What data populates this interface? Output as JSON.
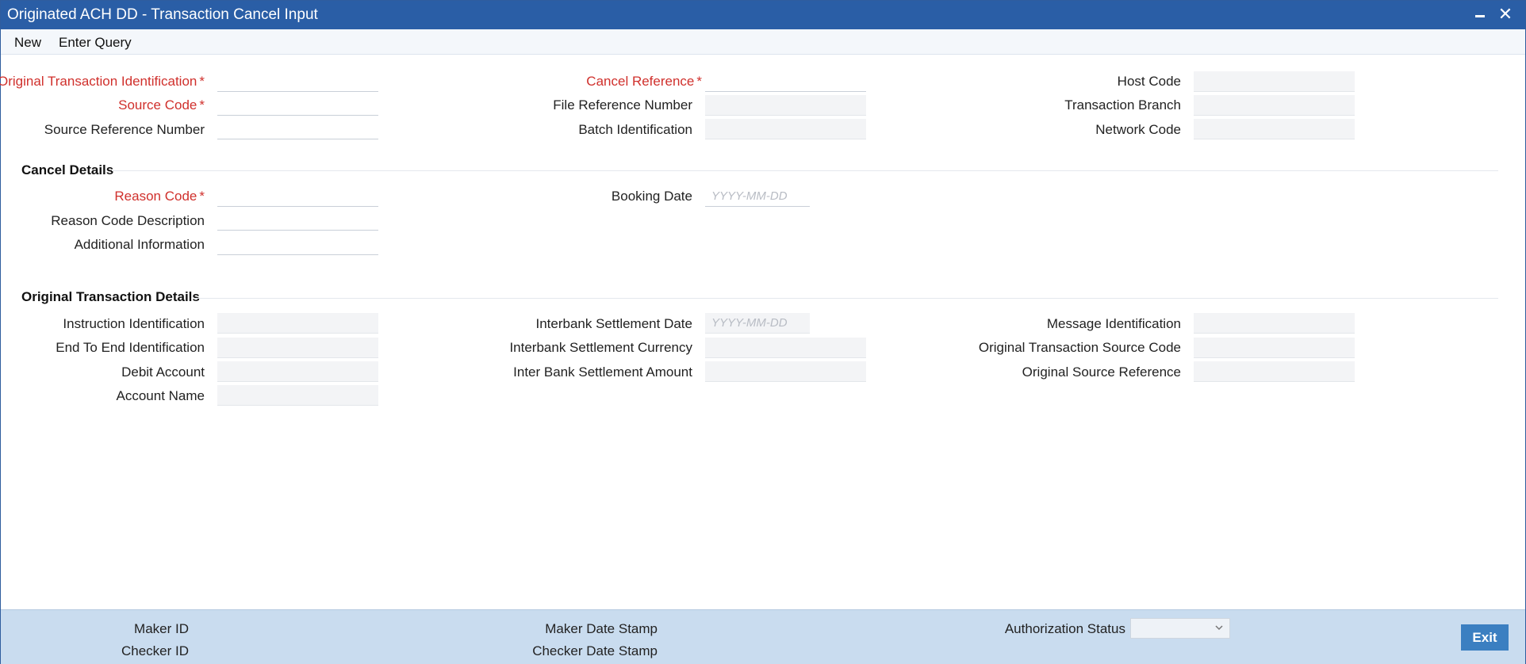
{
  "window": {
    "title": "Originated ACH DD - Transaction Cancel Input"
  },
  "menu": {
    "new_label": "New",
    "enter_query_label": "Enter Query"
  },
  "header_fields": {
    "original_txn_id": {
      "label": "Original Transaction Identification",
      "value": ""
    },
    "source_code": {
      "label": "Source Code",
      "value": ""
    },
    "source_ref_no": {
      "label": "Source Reference Number",
      "value": ""
    },
    "cancel_reference": {
      "label": "Cancel Reference",
      "value": ""
    },
    "file_ref_no": {
      "label": "File Reference Number",
      "value": ""
    },
    "batch_id": {
      "label": "Batch Identification",
      "value": ""
    },
    "host_code": {
      "label": "Host Code",
      "value": ""
    },
    "txn_branch": {
      "label": "Transaction Branch",
      "value": ""
    },
    "network_code": {
      "label": "Network Code",
      "value": ""
    },
    "required_mark": "*"
  },
  "cancel_details": {
    "section_title": "Cancel Details",
    "reason_code": {
      "label": "Reason Code",
      "value": ""
    },
    "reason_code_desc": {
      "label": "Reason Code Description",
      "value": ""
    },
    "additional_info": {
      "label": "Additional Information",
      "value": ""
    },
    "booking_date": {
      "label": "Booking Date",
      "value": "",
      "placeholder": "YYYY-MM-DD"
    }
  },
  "original_txn_details": {
    "section_title": "Original Transaction Details",
    "instruction_id": {
      "label": "Instruction Identification",
      "value": ""
    },
    "end_to_end_id": {
      "label": "End To End Identification",
      "value": ""
    },
    "debit_account": {
      "label": "Debit Account",
      "value": ""
    },
    "account_name": {
      "label": "Account Name",
      "value": ""
    },
    "ib_settlement_date": {
      "label": "Interbank Settlement Date",
      "value": "",
      "placeholder": "YYYY-MM-DD"
    },
    "ib_settlement_ccy": {
      "label": "Interbank Settlement Currency",
      "value": ""
    },
    "ib_settlement_amt": {
      "label": "Inter Bank Settlement Amount",
      "value": ""
    },
    "message_id": {
      "label": "Message Identification",
      "value": ""
    },
    "orig_txn_source_code": {
      "label": "Original Transaction Source Code",
      "value": ""
    },
    "orig_source_ref": {
      "label": "Original Source Reference",
      "value": ""
    }
  },
  "footer": {
    "maker_id_label": "Maker ID",
    "checker_id_label": "Checker ID",
    "maker_date_stamp_label": "Maker Date Stamp",
    "checker_date_stamp_label": "Checker Date Stamp",
    "authorization_status_label": "Authorization Status",
    "authorization_status_value": "",
    "exit_label": "Exit"
  },
  "colors": {
    "title_bar": "#2a5ea6",
    "required": "#d0302c",
    "footer_bg": "#c9dcef",
    "exit_button": "#3b7fc1"
  }
}
